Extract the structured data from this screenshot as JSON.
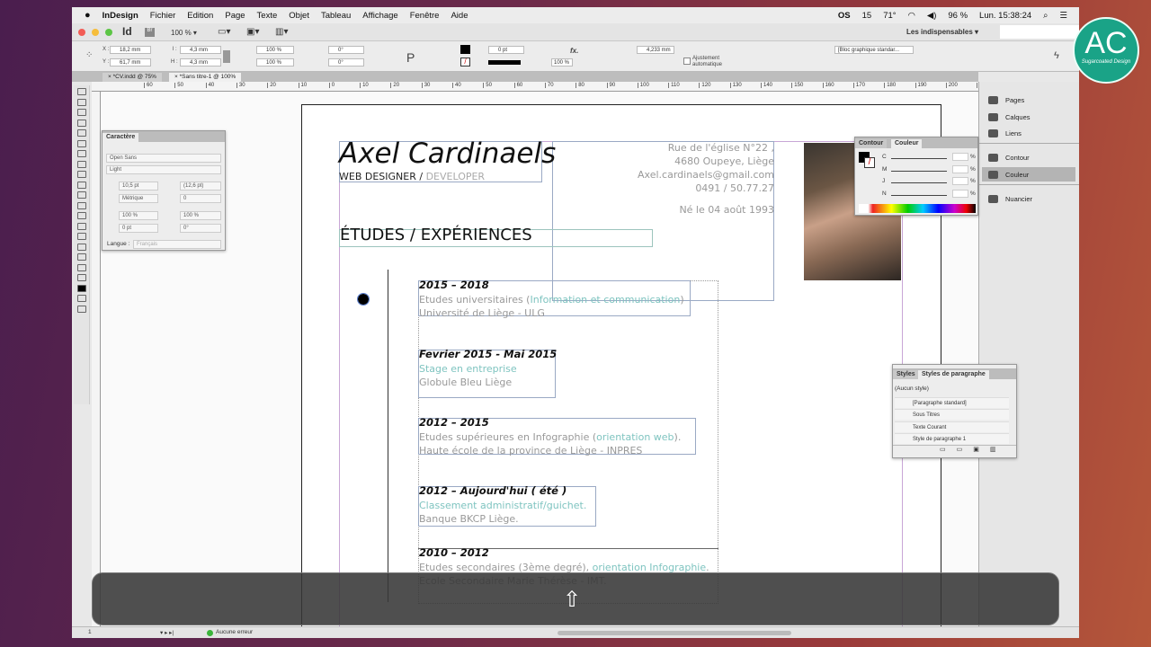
{
  "menubar": {
    "items": [
      "InDesign",
      "Fichier",
      "Edition",
      "Page",
      "Texte",
      "Objet",
      "Tableau",
      "Affichage",
      "Fenêtre",
      "Aide"
    ],
    "status": {
      "os": "OS",
      "calendar": "15",
      "temp": "71°",
      "battery": "96 %",
      "clock": "Lun. 15:38:24"
    }
  },
  "appbar": {
    "app": "Id",
    "bridge": "Br",
    "zoom": "100 % ▾",
    "workspace": "Les indispensables ▾"
  },
  "control": {
    "x": "18,2 mm",
    "y": "61,7 mm",
    "w": "4,3 mm",
    "h": "4,3 mm",
    "scale_x": "100 %",
    "scale_y": "100 %",
    "angle": "0°",
    "shear": "0°",
    "stroke": "0 pt",
    "opacity": "100 %",
    "offset": "4,233 mm",
    "autofit": "Ajustement automatique",
    "object_style": "[Bloc graphique standar...",
    "x_label": "X :",
    "y_label": "Y :",
    "w_label": "l :",
    "h_label": "H :"
  },
  "tabs": [
    "× *CV.indd @ 75%",
    "× *Sans titre-1 @ 100%"
  ],
  "ruler": [
    "60",
    "50",
    "40",
    "30",
    "20",
    "10",
    "0",
    "10",
    "20",
    "30",
    "40",
    "50",
    "60",
    "70",
    "80",
    "90",
    "100",
    "110",
    "120",
    "130",
    "140",
    "150",
    "160",
    "170",
    "180",
    "190",
    "200",
    "210"
  ],
  "cv": {
    "name": "Axel Cardinaels",
    "role_a": "WEB DESIGNER / ",
    "role_b": "DEVELOPER",
    "address": [
      "Rue de l'église N°22 ,",
      "4680 Oupeye, Liège",
      "Axel.cardinaels@gmail.com",
      "0491 / 50.77.27"
    ],
    "birth": "Né le  04 août 1993",
    "section": "ÉTUDES / EXPÉRIENCES",
    "entries": [
      {
        "year": "2015 – 2018",
        "l1a": "Etudes universitaires (",
        "l1b": "Information et communication",
        "l1c": ")",
        "l2": "Université de Liège - ULG"
      },
      {
        "year": "Fevrier 2015 - Mai 2015",
        "l1b": "Stage en entreprise",
        "l2": "Globule Bleu Liège"
      },
      {
        "year": "2012 – 2015",
        "l1a": "Etudes supérieures en Infographie (",
        "l1b": "orientation web",
        "l1c": ").",
        "l2": "Haute école de la province de Liège - INPRES"
      },
      {
        "year": "2012 – Aujourd'hui ( été )",
        "l1b": "Classement administratif/guichet.",
        "l2": "Banque BKCP Liège."
      },
      {
        "year": "2010 – 2012",
        "l1a": "Etudes secondaires (3ème degré), ",
        "l1b": "orientation Infographie",
        "l1c": ".",
        "l2": "Ecole Secondaire Marie Thérèse - IMT."
      }
    ]
  },
  "character": {
    "title": "Caractère",
    "font": "Open Sans",
    "style": "Light",
    "size": "10,5 pt",
    "leading": "(12,6 pt)",
    "kerning": "Métrique",
    "tracking": "0",
    "vscale": "100 %",
    "hscale": "100 %",
    "baseline": "0 pt",
    "skew": "0°",
    "lang_label": "Langue :",
    "lang": "Français"
  },
  "color": {
    "tab1": "Contour",
    "tab2": "Couleur",
    "channels": [
      "C",
      "M",
      "J",
      "N"
    ],
    "unit": "%"
  },
  "dock": [
    "Pages",
    "Calques",
    "Liens",
    "Contour",
    "Couleur",
    "Nuancier"
  ],
  "styles": {
    "tab1": "Styles",
    "tab2": "Styles de paragraphe",
    "current": "(Aucun style)",
    "items": [
      "[Paragraphe standard]",
      "Sous Titres",
      "Texte Courant",
      "Style de paragraphe 1"
    ]
  },
  "statusbar": {
    "page": "1",
    "errors": "Aucune erreur"
  },
  "logo": {
    "initials": "AC",
    "tagline": "Sugarcoated Design"
  },
  "colors": {
    "accent": "#7fc4c0",
    "logo": "#1aa387"
  }
}
